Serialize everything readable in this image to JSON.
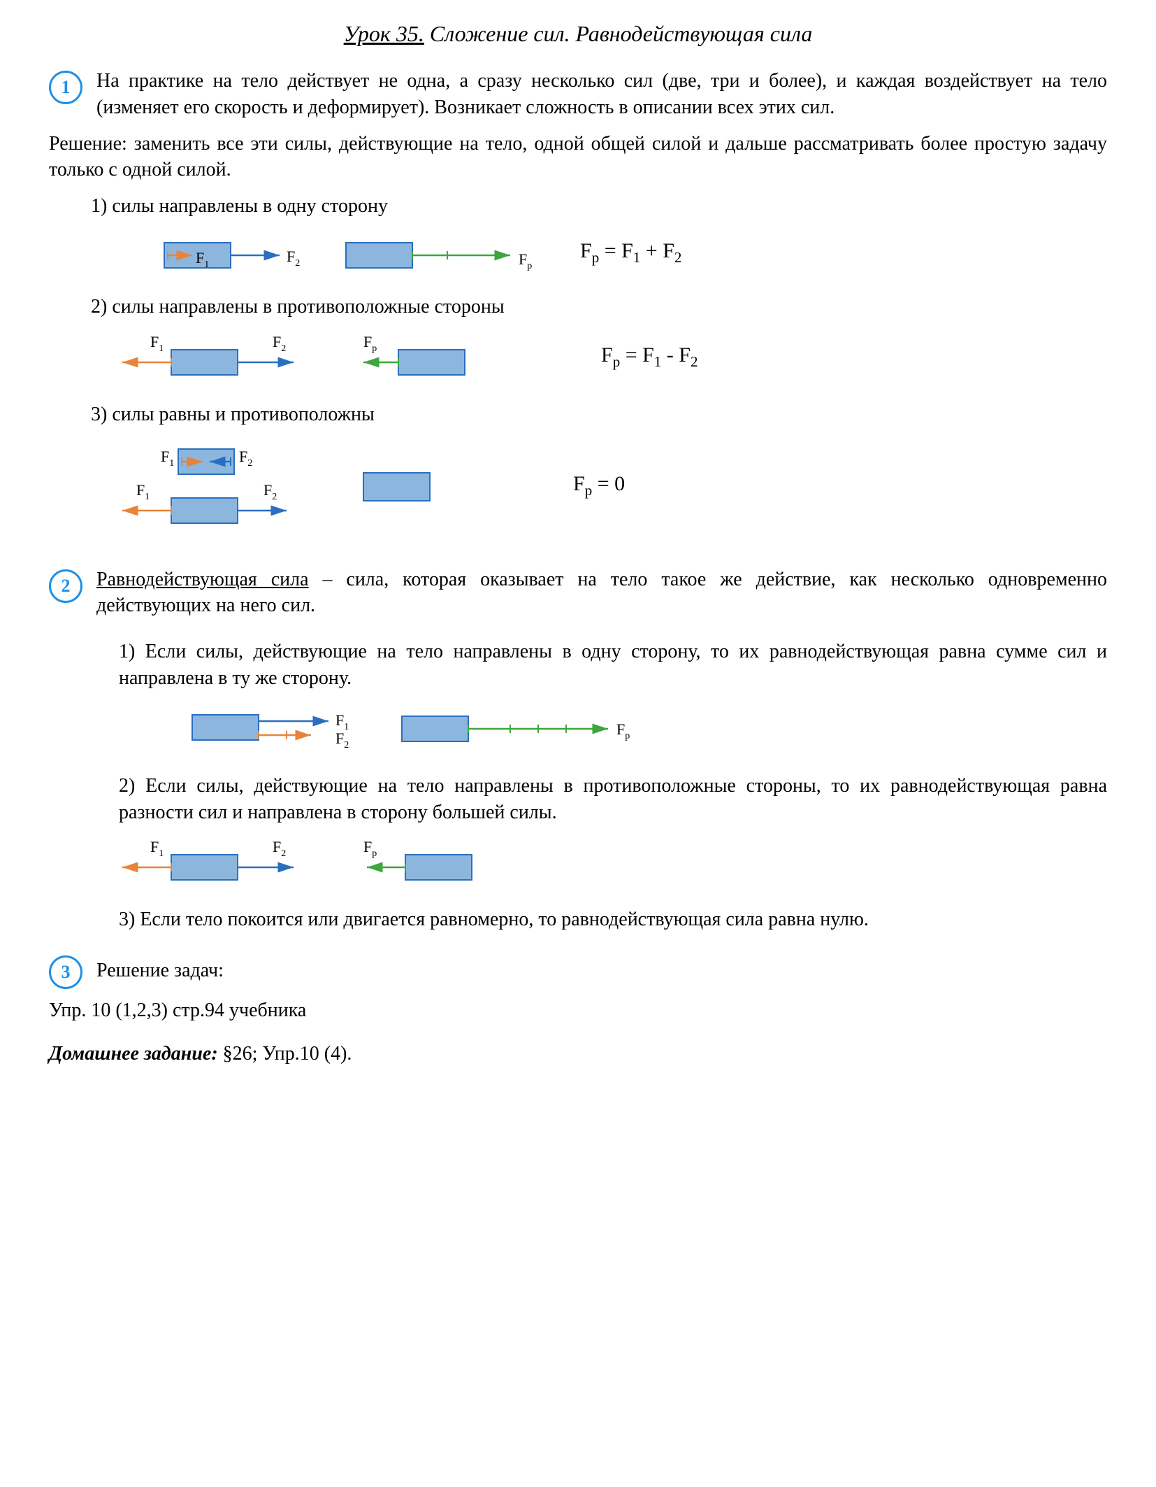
{
  "title_prefix": "Урок 35.",
  "title_rest": " Сложение сил. Равнодействующая сила",
  "sec1": {
    "num": "1",
    "p1": "На практике на тело действует не одна, а сразу несколько сил (две, три и более), и каждая воздействует на тело (изменяет его скорость и деформирует). Возникает сложность в описании всех этих сил.",
    "p2": "Решение: заменить все эти силы, действующие на тело, одной общей силой и дальше рассматривать более простую задачу только с одной силой.",
    "case1_label": "1)  силы направлены в одну сторону",
    "case2_label": "2)  силы направлены в противоположные стороны",
    "case3_label": "3)  силы равны и противоположны"
  },
  "labels": {
    "F1": "F",
    "F1sub": "1",
    "F2": "F",
    "F2sub": "2",
    "Fp": "F",
    "Fpsub": "p"
  },
  "formulas": {
    "sum_pre": "F",
    "sum": " = F",
    "sum_mid": " + F",
    "diff": " = F",
    "diff_mid": " - F",
    "zero": " = 0"
  },
  "sec2": {
    "num": "2",
    "lead_u": "Равнодействующая сила",
    "lead_rest": " – сила, которая оказывает на тело такое же действие, как несколько одновременно действующих на него сил.",
    "rule1": "1) Если силы, действующие на тело направлены в одну сторону, то их равнодействующая равна сумме сил и направлена в ту же сторону.",
    "rule2": "2)  Если силы, действующие на тело направлены в противоположные стороны, то их равнодействующая равна разности сил и направлена в сторону большей силы.",
    "rule3": "3)  Если тело покоится или двигается равномерно, то равнодействующая сила равна нулю."
  },
  "sec3": {
    "num": "3",
    "title": "Решение задач:",
    "tasks": "Упр. 10 (1,2,3) стр.94 учебника"
  },
  "hw_label": "Домашнее задание:",
  "hw_text": " §26; Упр.10 (4)."
}
